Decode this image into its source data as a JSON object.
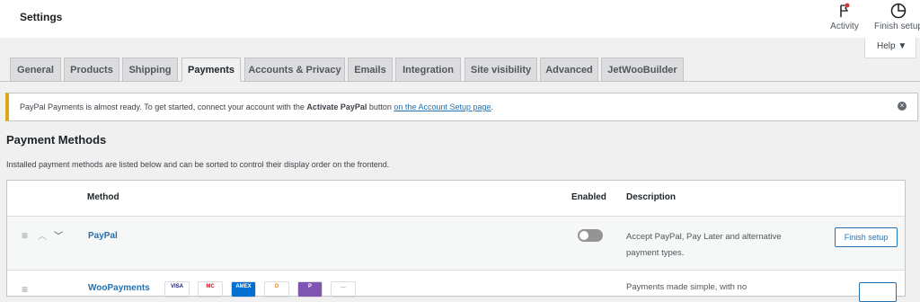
{
  "header": {
    "title": "Settings",
    "activity_label": "Activity",
    "finish_setup_label": "Finish setup",
    "help_label": "Help ▼"
  },
  "tabs": [
    {
      "label": "General",
      "active": false
    },
    {
      "label": "Products",
      "active": false
    },
    {
      "label": "Shipping",
      "active": false
    },
    {
      "label": "Payments",
      "active": true
    },
    {
      "label": "Accounts & Privacy",
      "active": false
    },
    {
      "label": "Emails",
      "active": false
    },
    {
      "label": "Integration",
      "active": false
    },
    {
      "label": "Site visibility",
      "active": false
    },
    {
      "label": "Advanced",
      "active": false
    },
    {
      "label": "JetWooBuilder",
      "active": false
    }
  ],
  "notice": {
    "text_before": "PayPal Payments is almost ready. To get started, connect your account with the ",
    "bold": "Activate PayPal",
    "text_middle": " button ",
    "link": "on the Account Setup page",
    "text_after": "."
  },
  "payment_methods": {
    "title": "Payment Methods",
    "description": "Installed payment methods are listed below and can be sorted to control their display order on the frontend.",
    "columns": {
      "method": "Method",
      "enabled": "Enabled",
      "description": "Description"
    },
    "rows": [
      {
        "name": "PayPal",
        "enabled": false,
        "description_line1": "Accept PayPal, Pay Later and alternative",
        "description_line2": "payment types.",
        "action_label": "Finish setup"
      },
      {
        "name": "WooPayments",
        "card_labels": [
          "VISA",
          "MC",
          "AMEX",
          "D",
          "P",
          "…"
        ],
        "description": "Payments made simple, with no"
      }
    ]
  },
  "colors": {
    "accent": "#2271b1",
    "notice_border": "#dba617",
    "background": "#f0f0f1"
  }
}
